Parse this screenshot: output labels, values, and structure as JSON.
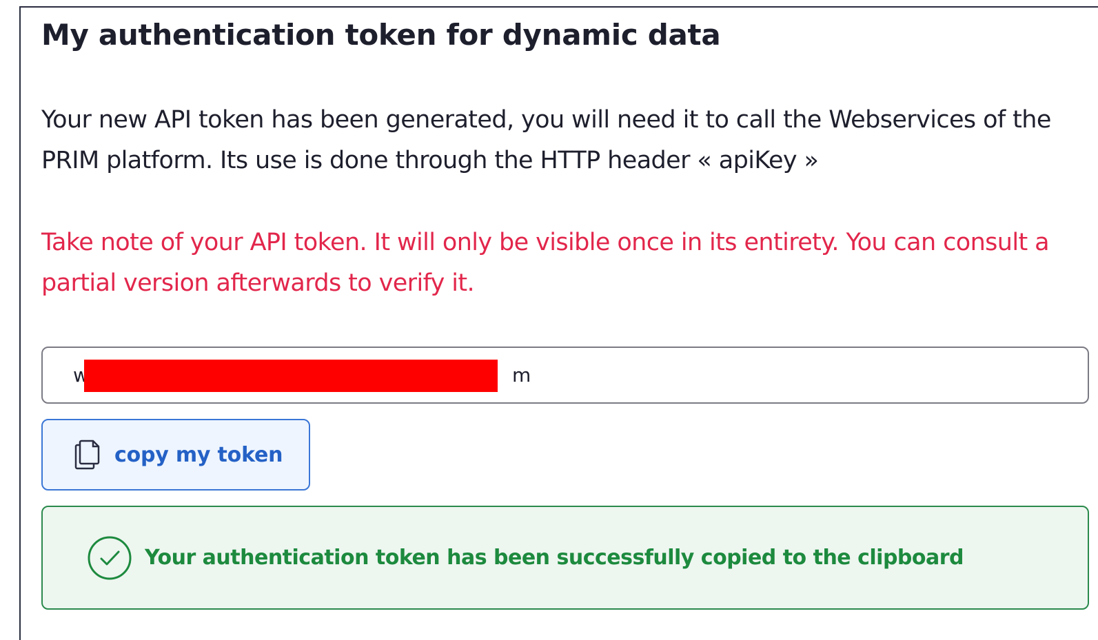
{
  "card": {
    "title": "My authentication token for dynamic data",
    "intro": "Your new API token has been generated, you will need it to call the Webservices of the PRIM platform. Its use is done through the HTTP header « apiKey »",
    "warning": "Take note of your API token. It will only be visible once in its entirety. You can consult a partial version afterwards to verify it.",
    "token_value": "w                                                                     m",
    "copy_button_label": "copy my token",
    "success_message": "Your authentication token has been successfully copied to the clipboard"
  },
  "icons": {
    "copy": "copy-icon",
    "success": "check-circle-icon"
  },
  "colors": {
    "title": "#1e1f2d",
    "warning": "#e2264b",
    "button_border": "#3a76d6",
    "button_text": "#2461c6",
    "success_border": "#2a8a4c",
    "success_text": "#1d8a3e",
    "redaction": "#ff0000"
  }
}
